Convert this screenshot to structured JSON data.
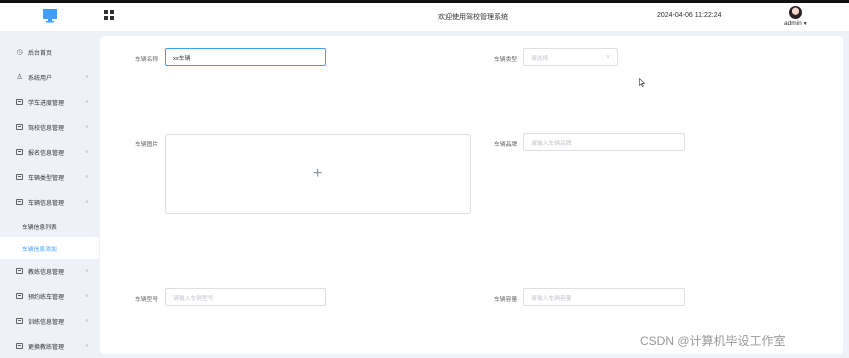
{
  "header": {
    "title": "欢迎使用驾校管理系统",
    "datetime": "2024-04-06 11:22:24",
    "user": "admin"
  },
  "sidebar": {
    "items": [
      {
        "label": "后台首页",
        "icon": "clock-icon"
      },
      {
        "label": "系统用户",
        "icon": "user-icon"
      },
      {
        "label": "学车进度管理",
        "icon": "box-icon"
      },
      {
        "label": "驾校信息管理",
        "icon": "box-icon"
      },
      {
        "label": "报名信息管理",
        "icon": "box-icon"
      },
      {
        "label": "车辆类型管理",
        "icon": "box-icon"
      },
      {
        "label": "车辆信息管理",
        "icon": "box-icon",
        "expanded": true
      },
      {
        "label": "教练信息管理",
        "icon": "box-icon"
      },
      {
        "label": "预约练车管理",
        "icon": "box-icon"
      },
      {
        "label": "训练信息管理",
        "icon": "box-icon"
      },
      {
        "label": "更换教练管理",
        "icon": "box-icon"
      }
    ],
    "sub_items": [
      {
        "label": "车辆信息列表"
      },
      {
        "label": "车辆信息添加",
        "active": true
      }
    ]
  },
  "form": {
    "name_label": "车辆名称",
    "name_value": "xx车辆",
    "type_label": "车辆类型",
    "type_placeholder": "请选择",
    "image_label": "车辆图片",
    "brand_label": "车辆品牌",
    "brand_placeholder": "请输入车辆品牌",
    "model_label": "车辆型号",
    "model_placeholder": "请输入车辆型号",
    "capacity_label": "车辆容量",
    "capacity_placeholder": "请输入车辆容量"
  },
  "watermark": "CSDN @计算机毕设工作室",
  "colors": {
    "accent": "#409eff",
    "background": "#eef2f8"
  }
}
